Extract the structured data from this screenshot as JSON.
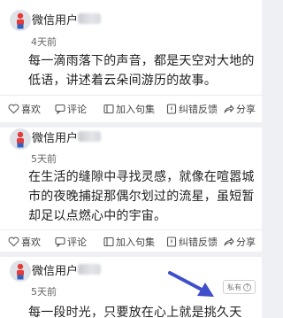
{
  "posts": [
    {
      "user": "微信用户",
      "time": "4天前",
      "content": "每一滴雨落下的声音，都是天空对大地的低语，讲述着云朵间游历的故事。"
    },
    {
      "user": "微信用户",
      "time": "5天前",
      "content": "在生活的缝隙中寻找灵感，就像在喧嚣城市的夜晚捕捉那偶尔划过的流星，虽短暂却足以点燃心中的宇宙。"
    },
    {
      "user": "微信用户",
      "time": "5天前",
      "content": "每一段时光，只要放在心上就是挑久天"
    }
  ],
  "actions": {
    "like": "喜欢",
    "comment": "评论",
    "quote": "加入句集",
    "report": "纠错反馈",
    "share": "分享"
  },
  "private_badge": "私有",
  "private_help": "?",
  "colors": {
    "arrow": "#3f4fc9",
    "avatar_person": "#e43b3b",
    "avatar_pants": "#2f5fbf"
  },
  "icons": [
    "heart-icon",
    "comment-icon",
    "quote-icon",
    "report-icon",
    "share-icon",
    "help-icon",
    "arrow-icon"
  ]
}
